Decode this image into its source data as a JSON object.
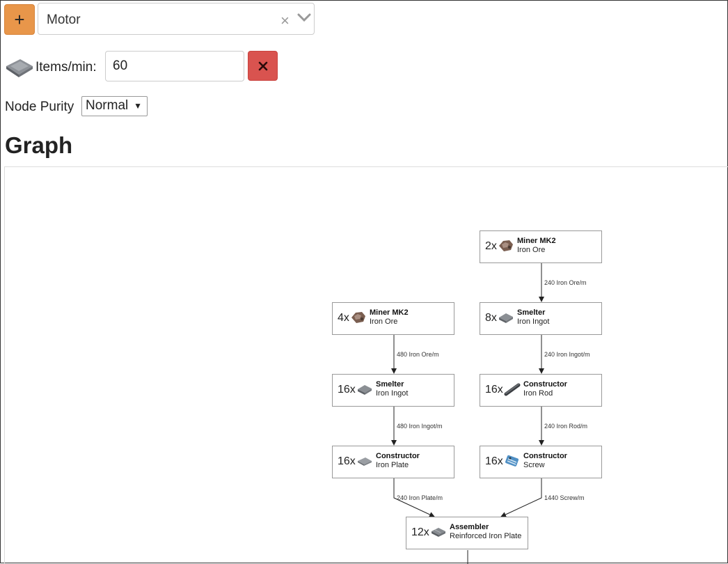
{
  "toolbar": {
    "add_label": "+",
    "selected_item": "Motor",
    "clear_glyph": "×"
  },
  "rate": {
    "label": "Items/min:",
    "value": "60"
  },
  "purity": {
    "label": "Node Purity",
    "selected": "Normal"
  },
  "graph": {
    "title": "Graph",
    "nodes": [
      {
        "count": "2x",
        "machine": "Miner MK2",
        "product": "Iron Ore",
        "icon": "ore-icon"
      },
      {
        "count": "4x",
        "machine": "Miner MK2",
        "product": "Iron Ore",
        "icon": "ore-icon"
      },
      {
        "count": "8x",
        "machine": "Smelter",
        "product": "Iron Ingot",
        "icon": "ingot-icon"
      },
      {
        "count": "16x",
        "machine": "Smelter",
        "product": "Iron Ingot",
        "icon": "ingot-icon"
      },
      {
        "count": "16x",
        "machine": "Constructor",
        "product": "Iron Rod",
        "icon": "rod-icon"
      },
      {
        "count": "16x",
        "machine": "Constructor",
        "product": "Iron Plate",
        "icon": "plate-icon"
      },
      {
        "count": "16x",
        "machine": "Constructor",
        "product": "Screw",
        "icon": "screw-icon"
      },
      {
        "count": "12x",
        "machine": "Assembler",
        "product": "Reinforced Iron Plate",
        "icon": "reinforced-plate-icon"
      }
    ],
    "edges": [
      {
        "label": "240 Iron Ore/m"
      },
      {
        "label": "480 Iron Ore/m"
      },
      {
        "label": "240 Iron Ingot/m"
      },
      {
        "label": "480 Iron Ingot/m"
      },
      {
        "label": "240 Iron Rod/m"
      },
      {
        "label": "240 Iron Plate/m"
      },
      {
        "label": "1440 Screw/m"
      }
    ]
  },
  "colors": {
    "add_button": "#e8964a",
    "delete_button": "#d9534f"
  }
}
